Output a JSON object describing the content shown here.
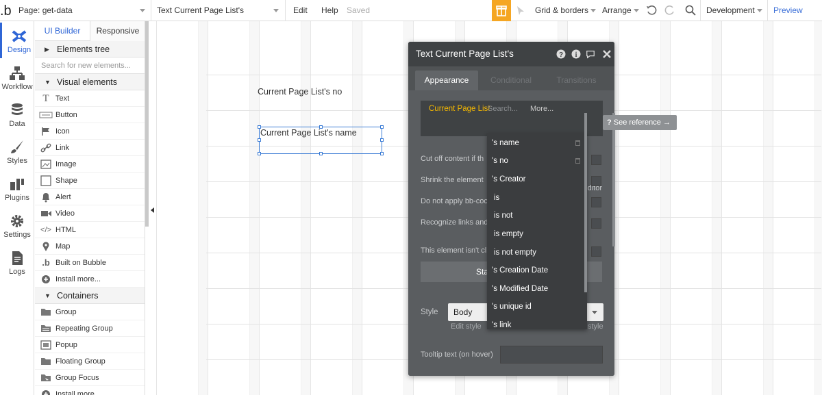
{
  "topbar": {
    "page_label": "Page: get-data",
    "element_label": "Text Current Page List's",
    "edit": "Edit",
    "help": "Help",
    "saved": "Saved",
    "grid": "Grid & borders",
    "arrange": "Arrange",
    "environment": "Development",
    "preview": "Preview"
  },
  "rail": [
    {
      "label": "Design",
      "icon": "design-icon"
    },
    {
      "label": "Workflow",
      "icon": "workflow-icon"
    },
    {
      "label": "Data",
      "icon": "database-icon"
    },
    {
      "label": "Styles",
      "icon": "brush-icon"
    },
    {
      "label": "Plugins",
      "icon": "plugin-icon"
    },
    {
      "label": "Settings",
      "icon": "gear-icon"
    },
    {
      "label": "Logs",
      "icon": "document-icon"
    }
  ],
  "palette": {
    "tab_ui": "UI Builder",
    "tab_responsive": "Responsive",
    "elements_tree": "Elements tree",
    "search_placeholder": "Search for new elements...",
    "visual_header": "Visual elements",
    "visual_items": [
      "Text",
      "Button",
      "Icon",
      "Link",
      "Image",
      "Shape",
      "Alert",
      "Video",
      "HTML",
      "Map",
      "Built on Bubble",
      "Install more..."
    ],
    "containers_header": "Containers",
    "container_items": [
      "Group",
      "Repeating Group",
      "Popup",
      "Floating Group",
      "Group Focus",
      "Install more..."
    ]
  },
  "canvas": {
    "text_no": "Current Page List's no",
    "text_name": "Current Page List's name"
  },
  "editor": {
    "title": "Text Current Page List's",
    "tabs": [
      "Appearance",
      "Conditional",
      "Transitions"
    ],
    "expr_ref": "Current Page List",
    "expr_search": "Search...",
    "expr_more": "More...",
    "rows": [
      "Cut off content if th",
      "Shrink the element",
      "Do not apply bb-coc",
      "Recognize links and",
      "This element isn't cl"
    ],
    "editor_tail": "ditor",
    "start_btn": "Sta",
    "style_label": "Style",
    "style_value": "Body",
    "edit_style": "Edit style",
    "style_tail": "style",
    "tooltip_label": "Tooltip text (on hover)"
  },
  "see_reference": "See reference →",
  "dropdown": [
    "'s name",
    "'s no",
    "'s Creator",
    "is",
    "is not",
    "is empty",
    "is not empty",
    "'s Creation Date",
    "'s Modified Date",
    "'s unique id",
    "'s link"
  ]
}
